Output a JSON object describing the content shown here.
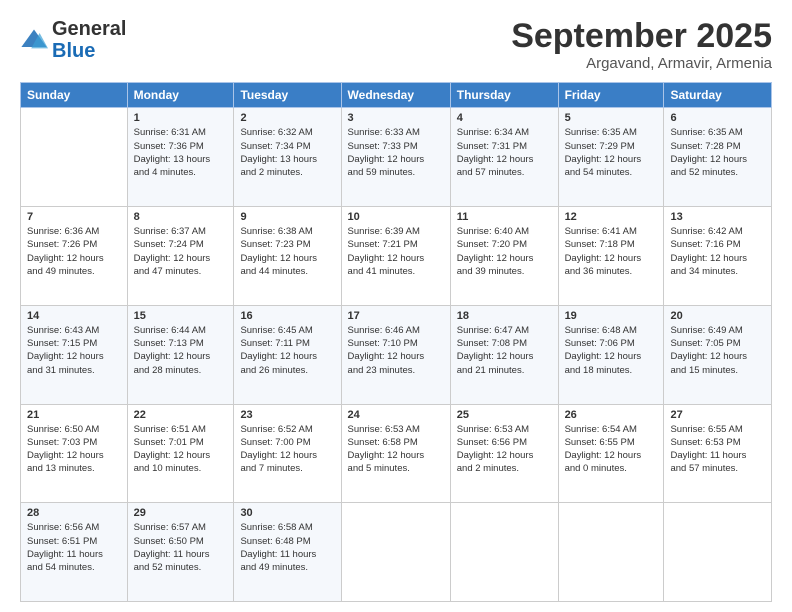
{
  "logo": {
    "line1": "General",
    "line2": "Blue"
  },
  "title": "September 2025",
  "location": "Argavand, Armavir, Armenia",
  "days_header": [
    "Sunday",
    "Monday",
    "Tuesday",
    "Wednesday",
    "Thursday",
    "Friday",
    "Saturday"
  ],
  "weeks": [
    [
      {
        "day": "",
        "info": ""
      },
      {
        "day": "1",
        "info": "Sunrise: 6:31 AM\nSunset: 7:36 PM\nDaylight: 13 hours\nand 4 minutes."
      },
      {
        "day": "2",
        "info": "Sunrise: 6:32 AM\nSunset: 7:34 PM\nDaylight: 13 hours\nand 2 minutes."
      },
      {
        "day": "3",
        "info": "Sunrise: 6:33 AM\nSunset: 7:33 PM\nDaylight: 12 hours\nand 59 minutes."
      },
      {
        "day": "4",
        "info": "Sunrise: 6:34 AM\nSunset: 7:31 PM\nDaylight: 12 hours\nand 57 minutes."
      },
      {
        "day": "5",
        "info": "Sunrise: 6:35 AM\nSunset: 7:29 PM\nDaylight: 12 hours\nand 54 minutes."
      },
      {
        "day": "6",
        "info": "Sunrise: 6:35 AM\nSunset: 7:28 PM\nDaylight: 12 hours\nand 52 minutes."
      }
    ],
    [
      {
        "day": "7",
        "info": "Sunrise: 6:36 AM\nSunset: 7:26 PM\nDaylight: 12 hours\nand 49 minutes."
      },
      {
        "day": "8",
        "info": "Sunrise: 6:37 AM\nSunset: 7:24 PM\nDaylight: 12 hours\nand 47 minutes."
      },
      {
        "day": "9",
        "info": "Sunrise: 6:38 AM\nSunset: 7:23 PM\nDaylight: 12 hours\nand 44 minutes."
      },
      {
        "day": "10",
        "info": "Sunrise: 6:39 AM\nSunset: 7:21 PM\nDaylight: 12 hours\nand 41 minutes."
      },
      {
        "day": "11",
        "info": "Sunrise: 6:40 AM\nSunset: 7:20 PM\nDaylight: 12 hours\nand 39 minutes."
      },
      {
        "day": "12",
        "info": "Sunrise: 6:41 AM\nSunset: 7:18 PM\nDaylight: 12 hours\nand 36 minutes."
      },
      {
        "day": "13",
        "info": "Sunrise: 6:42 AM\nSunset: 7:16 PM\nDaylight: 12 hours\nand 34 minutes."
      }
    ],
    [
      {
        "day": "14",
        "info": "Sunrise: 6:43 AM\nSunset: 7:15 PM\nDaylight: 12 hours\nand 31 minutes."
      },
      {
        "day": "15",
        "info": "Sunrise: 6:44 AM\nSunset: 7:13 PM\nDaylight: 12 hours\nand 28 minutes."
      },
      {
        "day": "16",
        "info": "Sunrise: 6:45 AM\nSunset: 7:11 PM\nDaylight: 12 hours\nand 26 minutes."
      },
      {
        "day": "17",
        "info": "Sunrise: 6:46 AM\nSunset: 7:10 PM\nDaylight: 12 hours\nand 23 minutes."
      },
      {
        "day": "18",
        "info": "Sunrise: 6:47 AM\nSunset: 7:08 PM\nDaylight: 12 hours\nand 21 minutes."
      },
      {
        "day": "19",
        "info": "Sunrise: 6:48 AM\nSunset: 7:06 PM\nDaylight: 12 hours\nand 18 minutes."
      },
      {
        "day": "20",
        "info": "Sunrise: 6:49 AM\nSunset: 7:05 PM\nDaylight: 12 hours\nand 15 minutes."
      }
    ],
    [
      {
        "day": "21",
        "info": "Sunrise: 6:50 AM\nSunset: 7:03 PM\nDaylight: 12 hours\nand 13 minutes."
      },
      {
        "day": "22",
        "info": "Sunrise: 6:51 AM\nSunset: 7:01 PM\nDaylight: 12 hours\nand 10 minutes."
      },
      {
        "day": "23",
        "info": "Sunrise: 6:52 AM\nSunset: 7:00 PM\nDaylight: 12 hours\nand 7 minutes."
      },
      {
        "day": "24",
        "info": "Sunrise: 6:53 AM\nSunset: 6:58 PM\nDaylight: 12 hours\nand 5 minutes."
      },
      {
        "day": "25",
        "info": "Sunrise: 6:53 AM\nSunset: 6:56 PM\nDaylight: 12 hours\nand 2 minutes."
      },
      {
        "day": "26",
        "info": "Sunrise: 6:54 AM\nSunset: 6:55 PM\nDaylight: 12 hours\nand 0 minutes."
      },
      {
        "day": "27",
        "info": "Sunrise: 6:55 AM\nSunset: 6:53 PM\nDaylight: 11 hours\nand 57 minutes."
      }
    ],
    [
      {
        "day": "28",
        "info": "Sunrise: 6:56 AM\nSunset: 6:51 PM\nDaylight: 11 hours\nand 54 minutes."
      },
      {
        "day": "29",
        "info": "Sunrise: 6:57 AM\nSunset: 6:50 PM\nDaylight: 11 hours\nand 52 minutes."
      },
      {
        "day": "30",
        "info": "Sunrise: 6:58 AM\nSunset: 6:48 PM\nDaylight: 11 hours\nand 49 minutes."
      },
      {
        "day": "",
        "info": ""
      },
      {
        "day": "",
        "info": ""
      },
      {
        "day": "",
        "info": ""
      },
      {
        "day": "",
        "info": ""
      }
    ]
  ]
}
